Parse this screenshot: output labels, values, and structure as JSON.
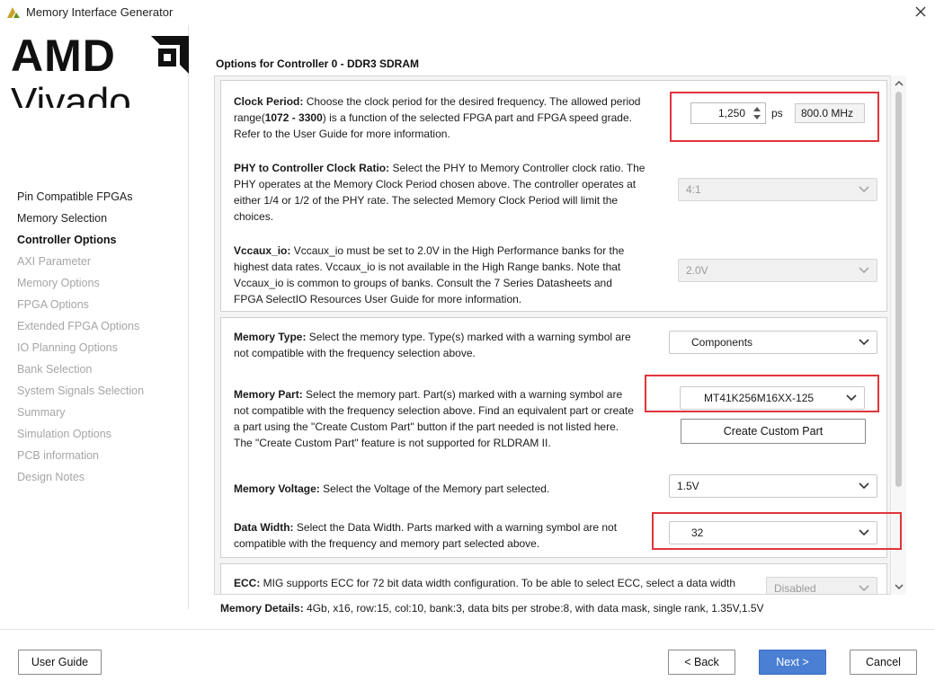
{
  "window": {
    "title": "Memory Interface Generator",
    "close_glyph": "✕"
  },
  "brand": {
    "company": "AMD",
    "product": "Vivado"
  },
  "sidebar": {
    "items": [
      {
        "label": "Pin Compatible FPGAs",
        "state": "done"
      },
      {
        "label": "Memory Selection",
        "state": "done"
      },
      {
        "label": "Controller Options",
        "state": "active"
      },
      {
        "label": "AXI Parameter",
        "state": "pending"
      },
      {
        "label": "Memory Options",
        "state": "pending"
      },
      {
        "label": "FPGA Options",
        "state": "pending"
      },
      {
        "label": "Extended FPGA Options",
        "state": "pending"
      },
      {
        "label": "IO Planning Options",
        "state": "pending"
      },
      {
        "label": "Bank Selection",
        "state": "pending"
      },
      {
        "label": "System Signals Selection",
        "state": "pending"
      },
      {
        "label": "Summary",
        "state": "pending"
      },
      {
        "label": "Simulation Options",
        "state": "pending"
      },
      {
        "label": "PCB information",
        "state": "pending"
      },
      {
        "label": "Design Notes",
        "state": "pending"
      }
    ]
  },
  "main": {
    "heading": "Options for Controller 0 - DDR3 SDRAM",
    "clock_period": {
      "title": "Clock Period:",
      "text1": " Choose the clock period for the desired frequency. The allowed period",
      "text2_pre": "range(",
      "range": "1072 - 3300",
      "text2_post": ") is a function of the selected FPGA part and FPGA speed grade.",
      "text3": "Refer to the User Guide for more information.",
      "value": "1,250",
      "unit": "ps",
      "frequency": "800.0 MHz"
    },
    "phy_ratio": {
      "title": "PHY to Controller Clock Ratio:",
      "text1": " Select the PHY to Memory Controller clock ratio. The",
      "text2": "PHY operates at the Memory Clock Period chosen above. The controller operates at",
      "text3": "either 1/4 or 1/2 of the PHY rate. The selected Memory Clock Period will limit the",
      "text4": "choices.",
      "value": "4:1"
    },
    "vccaux": {
      "title": "Vccaux_io:",
      "text1": " Vccaux_io must be set to 2.0V in the High Performance banks for the",
      "text2": "highest data rates. Vccaux_io is not available in the High Range banks. Note that",
      "text3": "Vccaux_io is common to groups of banks. Consult the 7 Series Datasheets and",
      "text4": "FPGA SelectIO Resources User Guide for more information.",
      "value": "2.0V"
    },
    "memory_type": {
      "title": "Memory Type:",
      "text1": " Select the memory type. Type(s) marked with a warning symbol are",
      "text2": "not compatible with the frequency selection above.",
      "value": "Components"
    },
    "memory_part": {
      "title": "Memory Part:",
      "text1": " Select the memory part. Part(s) marked with a warning symbol are",
      "text2": "not compatible with the frequency selection above. Find an equivalent part or create",
      "text3": "a part using the \"Create Custom Part\" button if the part needed is not listed here.",
      "text4": "The \"Create Custom Part\" feature is not supported for RLDRAM II.",
      "value": "MT41K256M16XX-125",
      "custom_button": "Create Custom Part"
    },
    "memory_voltage": {
      "title": "Memory Voltage:",
      "text1": " Select the Voltage of the Memory part selected.",
      "value": "1.5V"
    },
    "data_width": {
      "title": "Data Width:",
      "text1": " Select the Data Width. Parts marked with a warning symbol are not",
      "text2": "compatible with the frequency and memory part selected above.",
      "value": "32"
    },
    "ecc": {
      "title": "ECC:",
      "text1": " MIG supports ECC for 72 bit data width configuration. To be able to select ECC, select a data width",
      "value": "Disabled"
    },
    "memory_details": {
      "title": "Memory Details:",
      "text": " 4Gb, x16, row:15, col:10, bank:3, data bits per strobe:8, with data mask, single rank, 1.35V,1.5V"
    }
  },
  "footer": {
    "user_guide": "User Guide",
    "back": "< Back",
    "next": "Next >",
    "cancel": "Cancel"
  },
  "colors": {
    "highlight_box": "#e0353b",
    "primary_button": "#4a7fd4",
    "disabled_text": "#a6a6a6"
  }
}
